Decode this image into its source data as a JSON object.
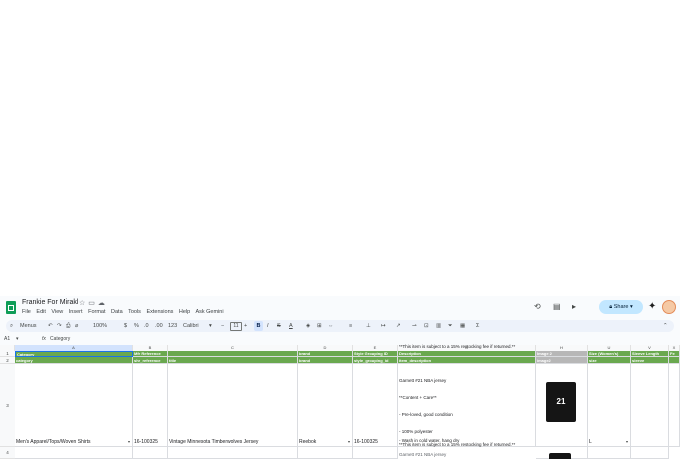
{
  "doc_title": "Frankie For Mirakl",
  "menu": [
    "File",
    "Edit",
    "View",
    "Insert",
    "Format",
    "Data",
    "Tools",
    "Extensions",
    "Help",
    "Ask Gemini"
  ],
  "toolbar": {
    "menus_label": "Menus",
    "zoom": "100%",
    "currency": "$",
    "percent": "%",
    "dec_less": ".0",
    "dec_more": ".00",
    "number_format": "123",
    "font": "Calibri",
    "font_size": "11",
    "bold": "B",
    "italic": "I",
    "strike": "S",
    "text_color": "A"
  },
  "share_label": "Share",
  "formula_bar": {
    "cell_ref": "A1",
    "fx": "fx",
    "content": "Category"
  },
  "columns": [
    "A",
    "B",
    "C",
    "D",
    "E",
    "F",
    "G",
    "H",
    "I",
    "U",
    "V",
    "X"
  ],
  "rows": [
    "1",
    "2",
    "3",
    "4"
  ],
  "header_row1": {
    "a": "Category",
    "b": "Mfr Reference",
    "c": "",
    "d": "brand",
    "e": "",
    "f": "Style Grouping ID",
    "g": "Description",
    "i": "Image 2",
    "u": "Size (Women's)",
    "v": "Sleeve Length",
    "x": "Fe"
  },
  "header_row2": {
    "a": "category",
    "b": "shr_reference",
    "c": "title",
    "d": "brand",
    "f": "style_grouping_id",
    "g": "item_description",
    "i": "image2",
    "u": "size",
    "v": "sleeve"
  },
  "row3": {
    "category": "Men's Apparel/Tops/Woven Shirts",
    "ref": "16-100325",
    "title": "Vintage Minnesota Timberwolves Jersey",
    "brand": "Reebok",
    "style_id": "16-100325",
    "size": "L",
    "description": [
      "**This item is subject to a 15% restocking fee if returned.**",
      "Garnett #21 NBA jersey",
      "**Content + Care**",
      "- Pre-loved, good condition",
      "- 100% polyester",
      "- Wash in cold water, hang dry"
    ],
    "jersey_number": "21"
  },
  "row4": {
    "description": [
      "**This item is subject to a 15% restocking fee if returned.**",
      "Garnett #21 NBA jersey"
    ]
  },
  "colors": {
    "header_green": "#6aa84f",
    "share_bg": "#c2e7ff",
    "toolbar_bg": "#edf2fa"
  }
}
